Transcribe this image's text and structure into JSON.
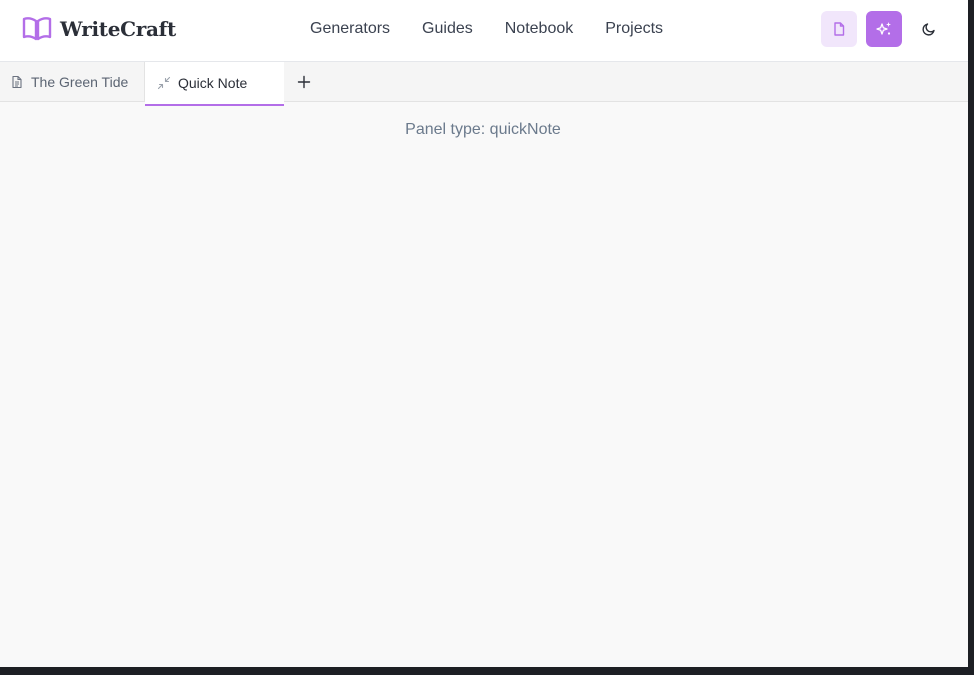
{
  "app": {
    "name": "WriteCraft"
  },
  "nav": {
    "items": [
      {
        "label": "Generators"
      },
      {
        "label": "Guides"
      },
      {
        "label": "Notebook"
      },
      {
        "label": "Projects"
      }
    ]
  },
  "header_actions": {
    "icons": [
      "document-icon",
      "sparkles-icon",
      "moon-icon"
    ]
  },
  "tabs": [
    {
      "label": "The Green Tide",
      "icon": "document-icon",
      "active": false
    },
    {
      "label": "Quick Note",
      "icon": "minimize-icon",
      "active": true
    }
  ],
  "panel": {
    "type_text": "Panel type: quickNote"
  },
  "colors": {
    "accent": "#b36ee8",
    "accent_light": "#f1e6fb",
    "text_dark": "#2b2f38",
    "text_muted": "#6b7a8c"
  }
}
